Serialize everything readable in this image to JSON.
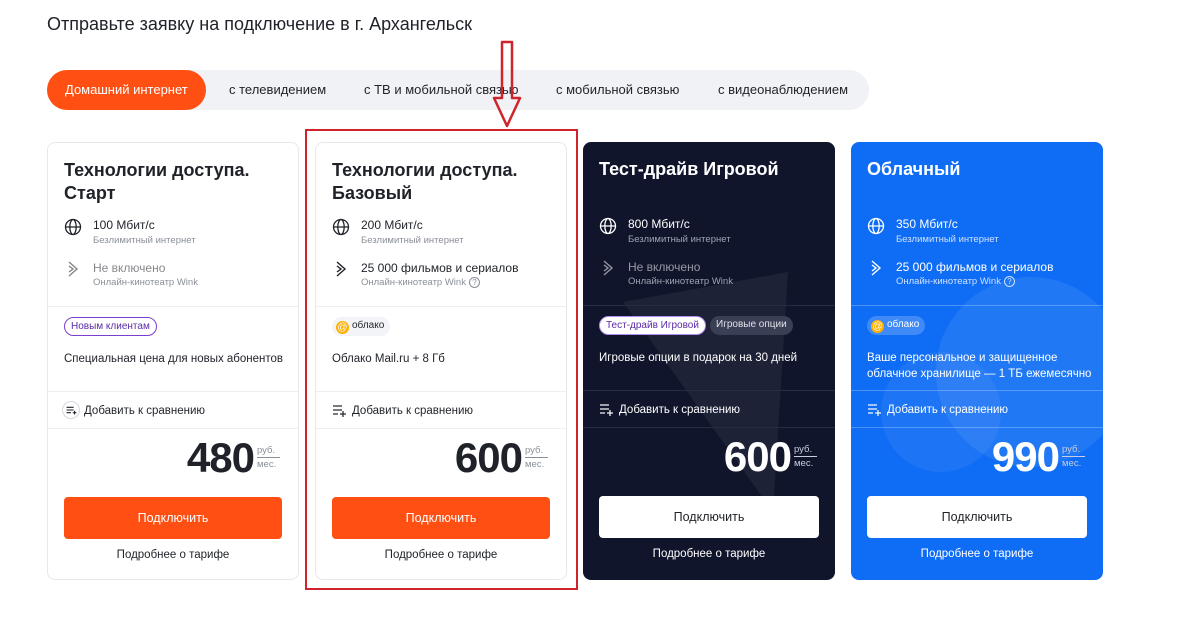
{
  "page_title": "Отправьте заявку на подключение в г. Архангельск",
  "tabs": [
    {
      "label": "Домашний интернет",
      "active": true
    },
    {
      "label": "с телевидением",
      "active": false
    },
    {
      "label": "с ТВ и мобильной связью",
      "active": false
    },
    {
      "label": "с мобильной связью",
      "active": false
    },
    {
      "label": "с видеонаблюдением",
      "active": false
    }
  ],
  "colors": {
    "accent": "#ff4f12",
    "dark_card": "#10152b",
    "blue_card": "#0f6df5",
    "annotation_red": "#d0232b"
  },
  "cards": [
    {
      "title": "Технологии доступа. Старт",
      "theme": "white",
      "speed": "100 Мбит/с",
      "speed_sub": "Безлимитный интернет",
      "cinema": "Не включено",
      "cinema_sub": "Онлайн-кинотеатр Wink",
      "badges": [
        "Новым клиентам"
      ],
      "offer": "Специальная цена для новых абонентов",
      "compare": "Добавить к сравнению",
      "price": "480",
      "unit_top": "руб.",
      "unit_bottom": "мес.",
      "connect": "Подключить",
      "details": "Подробнее о тарифе"
    },
    {
      "title": "Технологии доступа. Базовый",
      "theme": "white",
      "speed": "200 Мбит/с",
      "speed_sub": "Безлимитный интернет",
      "cinema": "25 000 фильмов и сериалов",
      "cinema_sub": "Онлайн-кинотеатр Wink",
      "badges": [
        "облако"
      ],
      "offer": "Облако Mail.ru + 8 Гб",
      "compare": "Добавить к сравнению",
      "price": "600",
      "unit_top": "руб.",
      "unit_bottom": "мес.",
      "connect": "Подключить",
      "details": "Подробнее о тарифе"
    },
    {
      "title": "Тест-драйв Игровой",
      "theme": "dark",
      "speed": "800 Мбит/с",
      "speed_sub": "Безлимитный интернет",
      "cinema": "Не включено",
      "cinema_sub": "Онлайн-кинотеатр Wink",
      "badges": [
        "Тест-драйв Игровой",
        "Игровые опции"
      ],
      "offer": "Игровые опции в подарок на 30 дней",
      "compare": "Добавить к сравнению",
      "price": "600",
      "unit_top": "руб.",
      "unit_bottom": "мес.",
      "connect": "Подключить",
      "details": "Подробнее о тарифе"
    },
    {
      "title": "Облачный",
      "theme": "blue",
      "speed": "350 Мбит/с",
      "speed_sub": "Безлимитный интернет",
      "cinema": "25 000 фильмов и сериалов",
      "cinema_sub": "Онлайн-кинотеатр Wink",
      "badges": [
        "облако"
      ],
      "offer": "Ваше персональное и защищенное облачное хранилище — 1 ТБ ежемесячно",
      "compare": "Добавить к сравнению",
      "price": "990",
      "unit_top": "руб.",
      "unit_bottom": "мес.",
      "connect": "Подключить",
      "details": "Подробнее о тарифе"
    }
  ],
  "icons": [
    "globe-icon",
    "wink-play-icon",
    "info-icon",
    "cloud-at-icon",
    "compare-list-icon",
    "down-arrow-annotation"
  ]
}
